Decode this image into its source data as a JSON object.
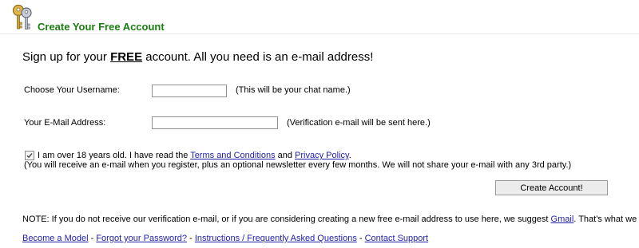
{
  "header": {
    "title": "Create Your Free Account",
    "icon": "keys-icon"
  },
  "intro": {
    "prefix": "Sign up for your ",
    "emphasis": "FREE",
    "suffix": " account.  All you need is an e-mail address!"
  },
  "form": {
    "username": {
      "label": "Choose Your Username:",
      "value": "",
      "hint": "(This will be your chat name.)"
    },
    "email": {
      "label": "Your E-Mail Address:",
      "value": "",
      "hint": "(Verification e-mail will be sent here.)"
    },
    "agreement": {
      "checked": true,
      "text_before": "I am over 18 years old.  I have read the ",
      "terms_link": "Terms and Conditions",
      "and": " and ",
      "privacy_link": "Privacy Policy",
      "period": ".",
      "privacy_note": "(You will receive an e-mail when you register, plus an optional newsletter every few months.  We will not share your e-mail with any 3rd party.)"
    },
    "submit_label": "Create Account!"
  },
  "note": {
    "text_before": "NOTE: If you do not receive our verification e-mail, or if you are considering creating a new free e-mail address to use here, we suggest ",
    "gmail_link": "Gmail",
    "text_after": ".  That's what we use! :-)"
  },
  "footer": {
    "links": [
      {
        "label": "Become a Model"
      },
      {
        "label": "Forgot your Password?"
      },
      {
        "label": "Instructions / Frequently Asked Questions"
      },
      {
        "label": "Contact Support"
      }
    ],
    "separator": " - "
  },
  "colors": {
    "title_green": "#1a7d10",
    "link_blue": "#1f1fa8",
    "button_bg": "#ececec"
  }
}
